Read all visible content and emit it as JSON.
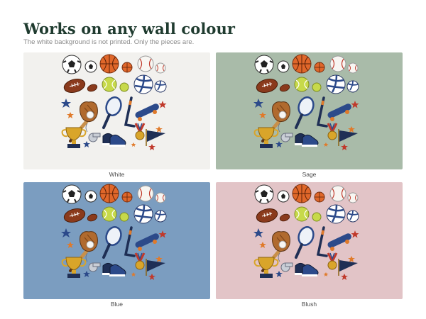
{
  "header": {
    "title": "Works on any wall colour",
    "subtitle": "The white background is not printed. Only the pieces are."
  },
  "panels": [
    {
      "name": "White",
      "color": "#f2f1ee"
    },
    {
      "name": "Sage",
      "color": "#a9bba9"
    },
    {
      "name": "Blue",
      "color": "#7b9dc0"
    },
    {
      "name": "Blush",
      "color": "#e2c4c7"
    }
  ],
  "icons": [
    "soccer-ball-icon",
    "basketball-icon",
    "baseball-icon",
    "football-icon",
    "tennis-ball-icon",
    "volleyball-icon",
    "baseball-bat-icon",
    "baseball-glove-icon",
    "tennis-racket-icon",
    "hockey-stick-icon",
    "skateboard-icon",
    "trophy-icon",
    "whistle-icon",
    "sneakers-icon",
    "medal-icon",
    "pennant-icon",
    "star-icon"
  ]
}
